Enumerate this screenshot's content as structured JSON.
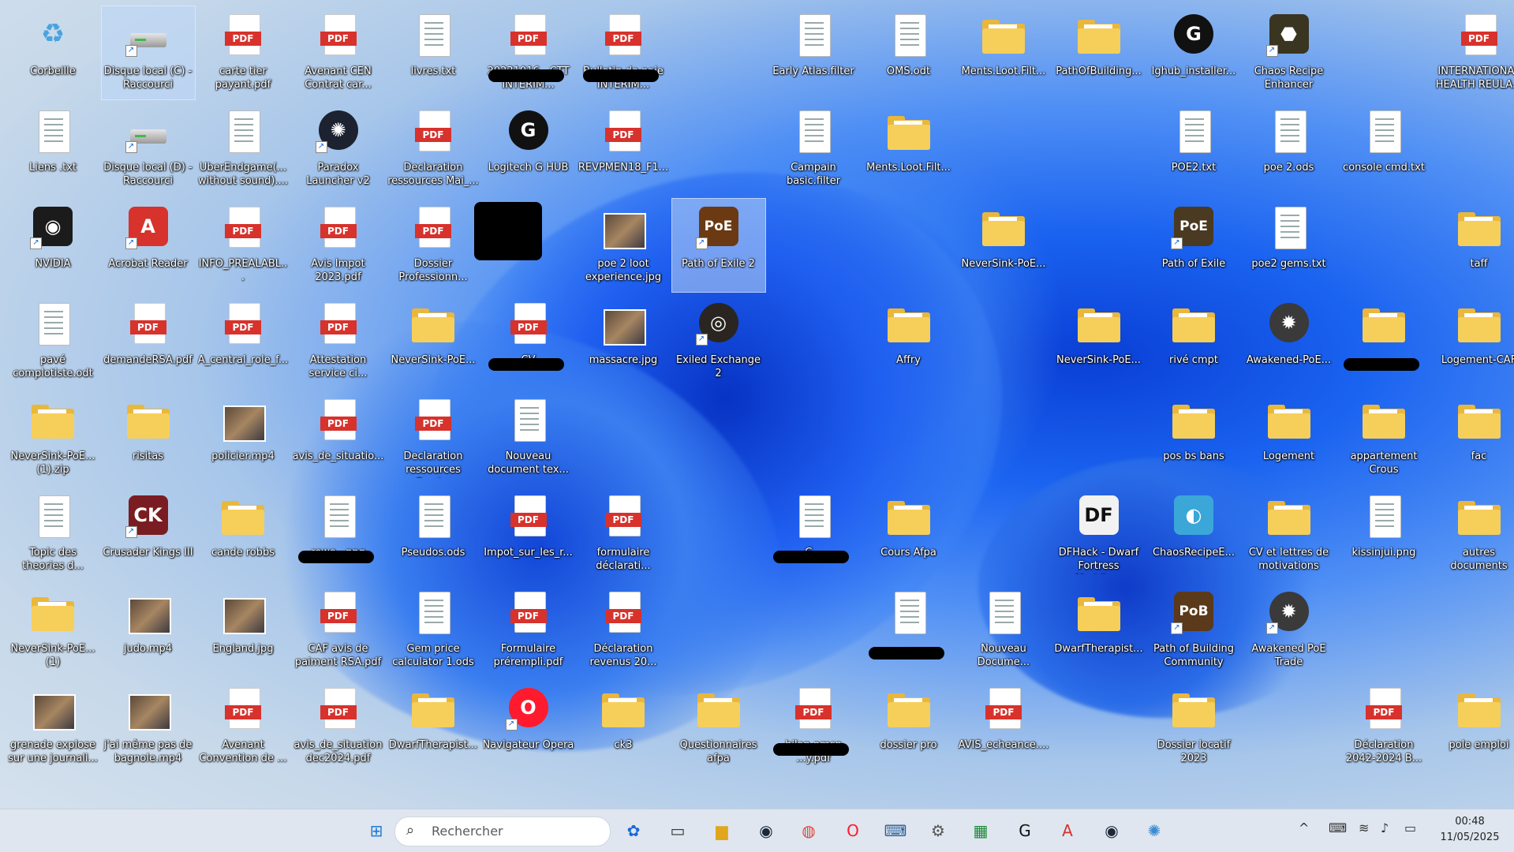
{
  "desktop": {
    "icons": [
      {
        "label": "Corbeille",
        "kind": "recycle",
        "col": 0,
        "row": 0
      },
      {
        "label": "Disque local (C) - Raccourci",
        "kind": "drive",
        "col": 1,
        "row": 0,
        "shortcut": true,
        "selected": true
      },
      {
        "label": "carte tier payant.pdf",
        "kind": "pdf",
        "col": 2,
        "row": 0
      },
      {
        "label": "Avenant CEN Contrat car...",
        "kind": "pdf",
        "col": 3,
        "row": 0
      },
      {
        "label": "livres.txt",
        "kind": "doc",
        "col": 4,
        "row": 0
      },
      {
        "label": "20231016 - CTT INTERIM...",
        "kind": "pdf",
        "col": 5,
        "row": 0,
        "redacted": true
      },
      {
        "label": "Bulletin de paie INTERIM...",
        "kind": "pdf",
        "col": 6,
        "row": 0,
        "redacted": true
      },
      {
        "label": "Early Atlas.filter",
        "kind": "doc",
        "col": 8,
        "row": 0
      },
      {
        "label": "OMS.odt",
        "kind": "doc",
        "col": 9,
        "row": 0
      },
      {
        "label": "Ments.Loot.Filt...",
        "kind": "folder",
        "col": 10,
        "row": 0
      },
      {
        "label": "PathOfBuilding...",
        "kind": "folder",
        "col": 11,
        "row": 0
      },
      {
        "label": "lghub_installer...",
        "kind": "app",
        "glyph": "G",
        "color": "#111111",
        "col": 12,
        "row": 0,
        "circle": true
      },
      {
        "label": "Chaos Recipe Enhancer",
        "kind": "app",
        "glyph": "⬣",
        "color": "#3a3520",
        "col": 13,
        "row": 0,
        "shortcut": true
      },
      {
        "label": "INTERNATIONAL HEALTH REULA...",
        "kind": "pdf",
        "col": 15,
        "row": 0
      },
      {
        "label": "Liens .txt",
        "kind": "doc",
        "col": 0,
        "row": 1
      },
      {
        "label": "Disque local (D) - Raccourci",
        "kind": "drive",
        "col": 1,
        "row": 1,
        "shortcut": true
      },
      {
        "label": "UberEndgame(... without sound)....",
        "kind": "doc",
        "col": 2,
        "row": 1
      },
      {
        "label": "Paradox Launcher v2",
        "kind": "app",
        "glyph": "✺",
        "color": "#1d2230",
        "col": 3,
        "row": 1,
        "circle": true,
        "shortcut": true
      },
      {
        "label": "Declaration ressources Mai_...",
        "kind": "pdf",
        "col": 4,
        "row": 1
      },
      {
        "label": "Logitech G HUB",
        "kind": "app",
        "glyph": "G",
        "color": "#111111",
        "col": 5,
        "row": 1,
        "circle": true
      },
      {
        "label": "REVPMEN18_F1...",
        "kind": "pdf",
        "col": 6,
        "row": 1
      },
      {
        "label": "Campain basic.filter",
        "kind": "doc",
        "col": 8,
        "row": 1
      },
      {
        "label": "Ments.Loot.Filt...",
        "kind": "folder",
        "col": 9,
        "row": 1
      },
      {
        "label": "POE2.txt",
        "kind": "doc",
        "col": 12,
        "row": 1
      },
      {
        "label": "poe 2.ods",
        "kind": "doc",
        "col": 13,
        "row": 1
      },
      {
        "label": "console cmd.txt",
        "kind": "doc",
        "col": 14,
        "row": 1
      },
      {
        "label": "NVIDIA",
        "kind": "app",
        "glyph": "◉",
        "color": "#1b1b1b",
        "col": 0,
        "row": 2,
        "shortcut": true
      },
      {
        "label": "Acrobat Reader",
        "kind": "app",
        "glyph": "A",
        "color": "#d7322c",
        "col": 1,
        "row": 2,
        "shortcut": true
      },
      {
        "label": "INFO_PREALABL...",
        "kind": "pdf",
        "col": 2,
        "row": 2
      },
      {
        "label": "Avis Impot 2023.pdf",
        "kind": "pdf",
        "col": 3,
        "row": 2
      },
      {
        "label": "Dossier Professionn...",
        "kind": "pdf",
        "col": 4,
        "row": 2
      },
      {
        "label": "",
        "kind": "redact",
        "col": 5,
        "row": 2
      },
      {
        "label": "poe 2 loot experience.jpg",
        "kind": "img",
        "col": 6,
        "row": 2
      },
      {
        "label": "Path of Exile 2",
        "kind": "app",
        "glyph": "PoE",
        "color": "#6b3a12",
        "col": 7,
        "row": 2,
        "shortcut": true,
        "selected": true
      },
      {
        "label": "NeverSink-PoE...",
        "kind": "folder",
        "col": 10,
        "row": 2
      },
      {
        "label": "Path of Exile",
        "kind": "app",
        "glyph": "PoE",
        "color": "#4a3a22",
        "col": 12,
        "row": 2,
        "shortcut": true
      },
      {
        "label": "poe2 gems.txt",
        "kind": "doc",
        "col": 13,
        "row": 2
      },
      {
        "label": "taff",
        "kind": "folder",
        "col": 15,
        "row": 2
      },
      {
        "label": "pavé complotiste.odt",
        "kind": "doc",
        "col": 0,
        "row": 3
      },
      {
        "label": "demandeRSA.pdf",
        "kind": "pdf",
        "col": 1,
        "row": 3
      },
      {
        "label": "A_central_role_f...",
        "kind": "pdf",
        "col": 2,
        "row": 3
      },
      {
        "label": "Attestation service ci...",
        "kind": "pdf",
        "col": 3,
        "row": 3
      },
      {
        "label": "NeverSink-PoE...",
        "kind": "folder",
        "col": 4,
        "row": 3
      },
      {
        "label": "CV",
        "kind": "pdf",
        "col": 5,
        "row": 3,
        "redacted": true
      },
      {
        "label": "massacre.jpg",
        "kind": "img",
        "col": 6,
        "row": 3
      },
      {
        "label": "Exiled Exchange 2",
        "kind": "app",
        "glyph": "◎",
        "color": "#2a2520",
        "col": 7,
        "row": 3,
        "circle": true,
        "shortcut": true
      },
      {
        "label": "Affry",
        "kind": "folder",
        "col": 9,
        "row": 3
      },
      {
        "label": "NeverSink-PoE...",
        "kind": "folder",
        "col": 11,
        "row": 3
      },
      {
        "label": "rivé cmpt",
        "kind": "folder",
        "col": 12,
        "row": 3
      },
      {
        "label": "Awakened-PoE...",
        "kind": "app",
        "glyph": "✹",
        "color": "#3a3a3a",
        "col": 13,
        "row": 3,
        "circle": true
      },
      {
        "label": "",
        "kind": "folder",
        "col": 14,
        "row": 3,
        "redacted": true
      },
      {
        "label": "Logement-CAF",
        "kind": "folder",
        "col": 15,
        "row": 3
      },
      {
        "label": "NeverSink-PoE... (1).zip",
        "kind": "folder",
        "col": 0,
        "row": 4
      },
      {
        "label": "risitas",
        "kind": "folder",
        "col": 1,
        "row": 4
      },
      {
        "label": "policier.mp4",
        "kind": "img",
        "col": 2,
        "row": 4
      },
      {
        "label": "avis_de_situatio...",
        "kind": "pdf",
        "col": 3,
        "row": 4
      },
      {
        "label": "Declaration ressources Fevri...",
        "kind": "pdf",
        "col": 4,
        "row": 4
      },
      {
        "label": "Nouveau document tex...",
        "kind": "doc",
        "col": 5,
        "row": 4
      },
      {
        "label": "pos bs bans",
        "kind": "folder",
        "col": 12,
        "row": 4
      },
      {
        "label": "Logement",
        "kind": "folder",
        "col": 13,
        "row": 4
      },
      {
        "label": "appartement Crous",
        "kind": "folder",
        "col": 14,
        "row": 4
      },
      {
        "label": "fac",
        "kind": "folder",
        "col": 15,
        "row": 4
      },
      {
        "label": "Topic des theories d...",
        "kind": "doc",
        "col": 0,
        "row": 5
      },
      {
        "label": "Crusader Kings III",
        "kind": "app",
        "glyph": "CK",
        "color": "#7a1d22",
        "col": 1,
        "row": 5,
        "shortcut": true
      },
      {
        "label": "cande robbs",
        "kind": "folder",
        "col": 2,
        "row": 5
      },
      {
        "label": "rewe...png",
        "kind": "doc",
        "col": 3,
        "row": 5,
        "redacted": true
      },
      {
        "label": "Pseudos.ods",
        "kind": "doc",
        "col": 4,
        "row": 5
      },
      {
        "label": "Impot_sur_les_r...",
        "kind": "pdf",
        "col": 5,
        "row": 5
      },
      {
        "label": "formulaire déclarati...",
        "kind": "pdf",
        "col": 6,
        "row": 5
      },
      {
        "label": "C...",
        "kind": "doc",
        "col": 8,
        "row": 5,
        "redacted": true
      },
      {
        "label": "Cours Afpa",
        "kind": "folder",
        "col": 9,
        "row": 5
      },
      {
        "label": "DFHack - Dwarf Fortress Moddin...",
        "kind": "app",
        "glyph": "DF",
        "color": "#f2f2f2",
        "dark": true,
        "col": 11,
        "row": 5
      },
      {
        "label": "ChaosRecipeE...",
        "kind": "app",
        "glyph": "◐",
        "color": "#3aa7d8",
        "col": 12,
        "row": 5
      },
      {
        "label": "CV et lettres de motivations",
        "kind": "folder",
        "col": 13,
        "row": 5
      },
      {
        "label": "kissinjui.png",
        "kind": "doc",
        "col": 14,
        "row": 5
      },
      {
        "label": "autres documents",
        "kind": "folder",
        "col": 15,
        "row": 5
      },
      {
        "label": "NeverSink-PoE... (1)",
        "kind": "folder",
        "col": 0,
        "row": 6
      },
      {
        "label": "judo.mp4",
        "kind": "img",
        "col": 1,
        "row": 6
      },
      {
        "label": "England.jpg",
        "kind": "img",
        "col": 2,
        "row": 6
      },
      {
        "label": "CAF avis de paiment RSA.pdf",
        "kind": "pdf",
        "col": 3,
        "row": 6
      },
      {
        "label": "Gem price calculator 1.ods",
        "kind": "doc",
        "col": 4,
        "row": 6
      },
      {
        "label": "Formulaire prérempli.pdf",
        "kind": "pdf",
        "col": 5,
        "row": 6
      },
      {
        "label": "Déclaration revenus 20...",
        "kind": "pdf",
        "col": 6,
        "row": 6
      },
      {
        "label": "",
        "kind": "doc",
        "col": 9,
        "row": 6,
        "redacted": true
      },
      {
        "label": "Nouveau Docume...",
        "kind": "doc",
        "col": 10,
        "row": 6
      },
      {
        "label": "DwarfTherapist...",
        "kind": "folder",
        "col": 11,
        "row": 6
      },
      {
        "label": "Path of Building Community",
        "kind": "app",
        "glyph": "PoB",
        "color": "#5a3a1a",
        "col": 12,
        "row": 6,
        "shortcut": true
      },
      {
        "label": "Awakened PoE Trade",
        "kind": "app",
        "glyph": "✹",
        "color": "#3a3a3a",
        "col": 13,
        "row": 6,
        "circle": true,
        "shortcut": true
      },
      {
        "label": "grenade explose sur une journali...",
        "kind": "img",
        "col": 0,
        "row": 7
      },
      {
        "label": "j'ai même pas de bagnole.mp4",
        "kind": "img",
        "col": 1,
        "row": 7
      },
      {
        "label": "Avenant Convention de ...",
        "kind": "pdf",
        "col": 2,
        "row": 7
      },
      {
        "label": "avis_de_situation dec2024.pdf",
        "kind": "pdf",
        "col": 3,
        "row": 7
      },
      {
        "label": "DwarfTherapist...",
        "kind": "folder",
        "col": 4,
        "row": 7
      },
      {
        "label": "Navigateur Opera",
        "kind": "app",
        "glyph": "O",
        "color": "#ff1b2d",
        "col": 5,
        "row": 7,
        "circle": true,
        "shortcut": true
      },
      {
        "label": "ck3",
        "kind": "folder",
        "col": 6,
        "row": 7
      },
      {
        "label": "Questionnaires afpa",
        "kind": "folder",
        "col": 7,
        "row": 7
      },
      {
        "label": "bilan pmsp ...y.pdf",
        "kind": "pdf",
        "col": 8,
        "row": 7,
        "redacted": true
      },
      {
        "label": "dossier pro",
        "kind": "folder",
        "col": 9,
        "row": 7
      },
      {
        "label": "AVIS_echeance....",
        "kind": "pdf",
        "col": 10,
        "row": 7
      },
      {
        "label": "Dossier locatif 2023",
        "kind": "folder",
        "col": 12,
        "row": 7
      },
      {
        "label": "Déclaration 2042-2024 B...",
        "kind": "pdf",
        "col": 14,
        "row": 7
      },
      {
        "label": "pole emploi",
        "kind": "folder",
        "col": 15,
        "row": 7
      }
    ]
  },
  "taskbar": {
    "search_placeholder": "Rechercher",
    "apps": [
      {
        "name": "start-button",
        "glyph": "⊞",
        "color": "#1c7ad6"
      },
      {
        "name": "copilot-icon",
        "glyph": "✿",
        "color": "#1a6ad6"
      },
      {
        "name": "task-view-icon",
        "glyph": "▭",
        "color": "#333333"
      },
      {
        "name": "file-explorer-icon",
        "glyph": "▆",
        "color": "#e0a61c"
      },
      {
        "name": "steam-icon",
        "glyph": "◉",
        "color": "#1b2838"
      },
      {
        "name": "chrome-icon",
        "glyph": "◍",
        "color": "#db4437"
      },
      {
        "name": "opera-icon",
        "glyph": "O",
        "color": "#ff1b2d"
      },
      {
        "name": "keyboard-app-icon",
        "glyph": "⌨",
        "color": "#2b5d9a"
      },
      {
        "name": "settings-icon",
        "glyph": "⚙",
        "color": "#555555"
      },
      {
        "name": "spreadsheet-icon",
        "glyph": "▦",
        "color": "#1d8a3a"
      },
      {
        "name": "logitech-icon",
        "glyph": "G",
        "color": "#111111"
      },
      {
        "name": "acrobat-icon",
        "glyph": "A",
        "color": "#d7322c"
      },
      {
        "name": "steam-icon-2",
        "glyph": "◉",
        "color": "#1b2838"
      },
      {
        "name": "app-icon",
        "glyph": "✺",
        "color": "#3a8ad0"
      }
    ],
    "tray": {
      "chevron": "^",
      "keyboard": "⌨",
      "wifi": "≋",
      "volume": "♪",
      "battery": "▭"
    },
    "clock": {
      "time": "00:48",
      "date": "11/05/2025"
    }
  }
}
